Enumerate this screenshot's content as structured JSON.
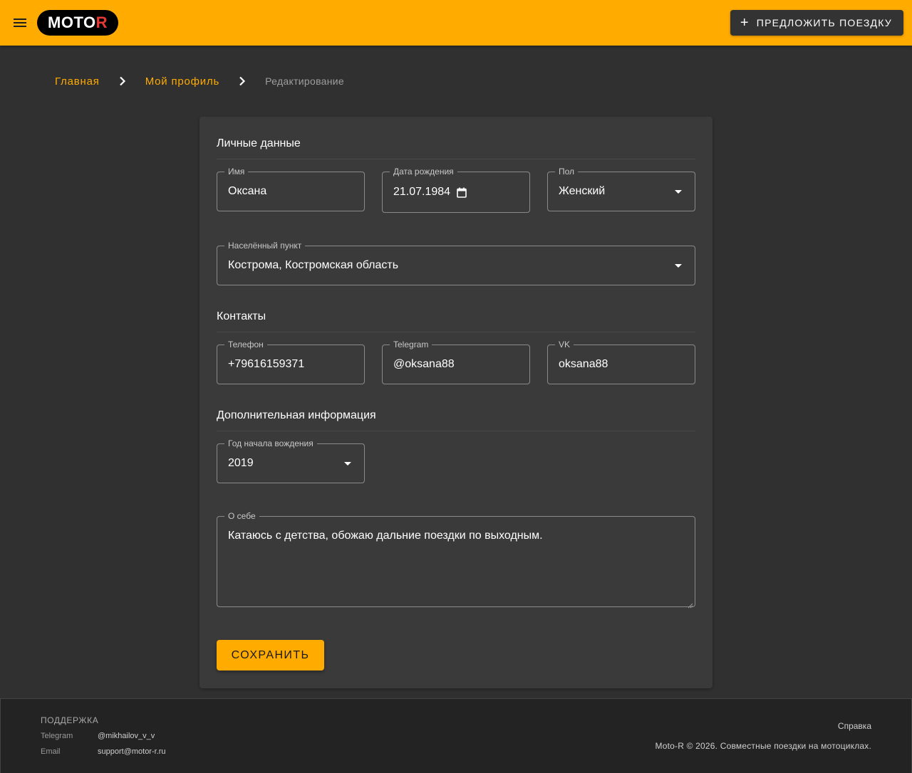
{
  "app": {
    "logo_main": "MOTO",
    "logo_accent": "R",
    "suggest_label": "ПРЕДЛОЖИТЬ ПОЕЗДКУ",
    "accent_color": "#ffab00",
    "logo_accent_color": "#e53935"
  },
  "breadcrumb": {
    "home": "Главная",
    "profile": "Мой профиль",
    "current": "Редактирование"
  },
  "form": {
    "personal": {
      "title": "Личные данные",
      "name": {
        "label": "Имя",
        "value": "Оксана"
      },
      "birthdate": {
        "label": "Дата рождения",
        "value": "21.07.1984"
      },
      "gender": {
        "label": "Пол",
        "value": "Женский"
      },
      "city": {
        "label": "Населённый пункт",
        "value": "Кострома, Костромская область"
      }
    },
    "contacts": {
      "title": "Контакты",
      "phone": {
        "label": "Телефон",
        "value": "+79616159371"
      },
      "telegram": {
        "label": "Telegram",
        "value": "@oksana88"
      },
      "vk": {
        "label": "VK",
        "value": "oksana88"
      }
    },
    "extra": {
      "title": "Дополнительная информация",
      "riding_since": {
        "label": "Год начала вождения",
        "value": "2019"
      },
      "about": {
        "label": "О себе",
        "value": "Катаюсь с детства, обожаю дальние поездки по выходным."
      }
    },
    "save_label": "СОХРАНИТЬ"
  },
  "footer": {
    "support_title": "ПОДДЕРЖКА",
    "telegram_key": "Telegram",
    "telegram_value": "@mikhailov_v_v",
    "email_key": "Email",
    "email_value": "support@motor-r.ru",
    "help": "Справка",
    "copyright": "Moto-R © 2026. Совместные поездки на мотоциклах."
  },
  "icons": {
    "menu": "menu-icon",
    "add": "plus-icon",
    "breadcrumb_separator": "chevron-right-icon",
    "date_picker": "calendar-icon",
    "select": "dropdown-arrow-icon"
  }
}
